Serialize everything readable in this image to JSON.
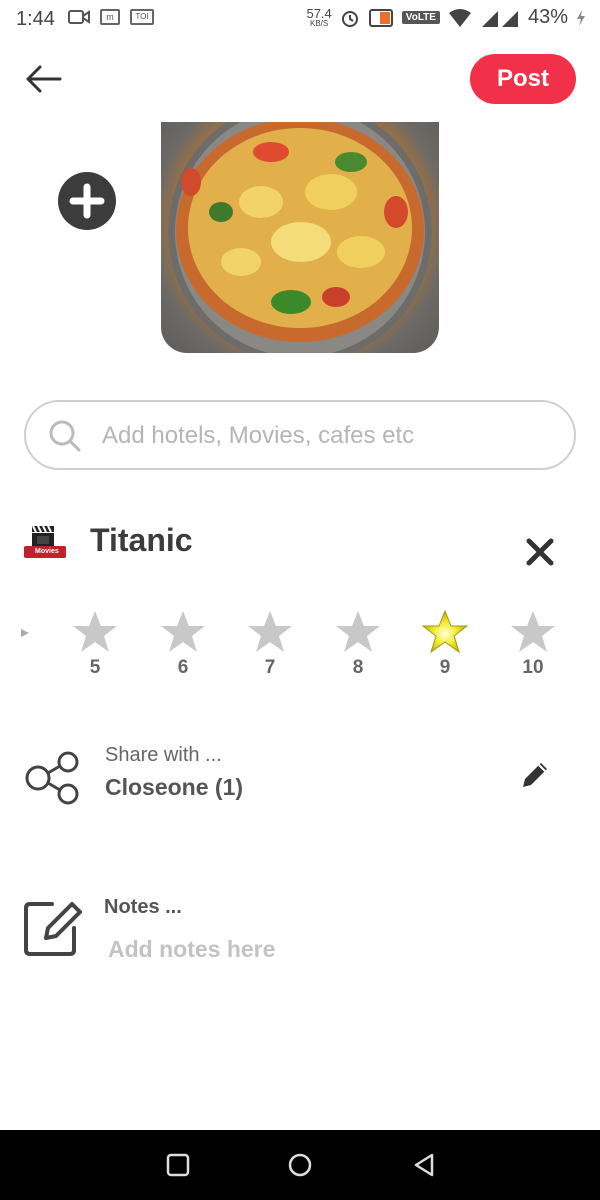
{
  "status_bar": {
    "time": "1:44",
    "left_icons": [
      "video-icon",
      "m-icon",
      "toi-icon"
    ],
    "toi_label": "TOI",
    "m_label": "m",
    "speed_value": "57.4",
    "speed_unit": "KB/S",
    "volte_label": "VoLTE",
    "battery": "43%"
  },
  "header": {
    "post_label": "Post"
  },
  "search": {
    "placeholder": "Add hotels, Movies, cafes etc"
  },
  "item": {
    "title": "Titanic",
    "logo_label": "Movies"
  },
  "rating": {
    "numbers": [
      "5",
      "6",
      "7",
      "8",
      "9",
      "10"
    ],
    "selected": "9",
    "colors": {
      "selected": "#d9d400",
      "unselected": "#c8c8c8"
    }
  },
  "share": {
    "label": "Share with ...",
    "value": "Closeone  (1)"
  },
  "notes": {
    "label": "Notes ...",
    "placeholder": "Add notes here"
  },
  "colors": {
    "accent": "#f2304a",
    "nav_bg": "#000000"
  }
}
